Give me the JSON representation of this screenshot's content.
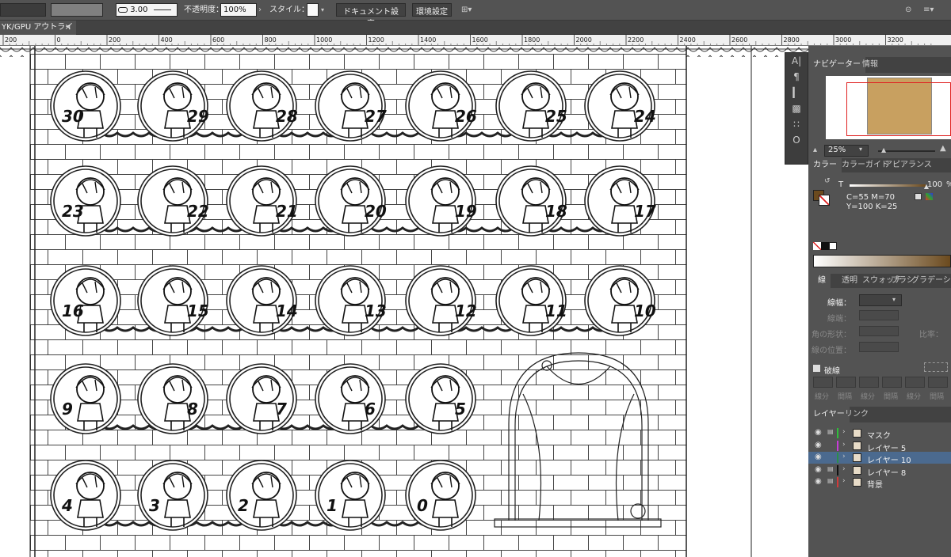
{
  "toolbar": {
    "stroke_weight": "3.00",
    "opacity_label": "不透明度：",
    "opacity_value": "100%",
    "style_label": "スタイル：",
    "doc_settings_button": "ドキュメント設定",
    "preferences_button": "環境設定"
  },
  "doc_tab": {
    "title": "YK/GPU アウトライン)",
    "close": "×"
  },
  "ruler": {
    "labels": [
      "200",
      "0",
      "200",
      "400",
      "600",
      "800",
      "1000",
      "1200",
      "1400",
      "1600",
      "1800",
      "2000",
      "2200",
      "2400",
      "2600",
      "2800",
      "3000",
      "3200"
    ]
  },
  "artwork": {
    "medallion_numbers": [
      "30",
      "29",
      "28",
      "27",
      "26",
      "25",
      "24",
      "23",
      "22",
      "21",
      "20",
      "19",
      "18",
      "17",
      "16",
      "15",
      "14",
      "13",
      "12",
      "11",
      "10",
      "9",
      "8",
      "7",
      "6",
      "5",
      "4",
      "3",
      "2",
      "1",
      "0"
    ]
  },
  "navigator": {
    "tab_navigator": "ナビゲーター",
    "tab_info": "情報",
    "zoom": "25%"
  },
  "color_panel": {
    "tab_color": "カラー",
    "tab_color_guide": "カラーガイド",
    "tab_appearance": "アピアランス",
    "tint_label": "T",
    "tint_value": "100",
    "tint_unit": "%",
    "cmyk_line1": "C=55 M=70",
    "cmyk_line2": "Y=100 K=25",
    "swatch_color": "#6b4a1e"
  },
  "stroke_panel": {
    "tab_stroke": "線",
    "tab_transparency": "透明",
    "tab_swatches": "スウォッチ",
    "tab_brush": "ブラシ",
    "tab_gradient": "グラデーション",
    "weight_label": "線幅：",
    "cap_label": "線端：",
    "corner_label": "角の形状：",
    "ratio_label": "比率：",
    "align_label": "線の位置："
  },
  "pathfinder": {
    "title": "破線",
    "labels": [
      "線分",
      "間隔",
      "線分",
      "間隔",
      "線分",
      "間隔"
    ]
  },
  "layers_panel": {
    "tab_layers": "レイヤー",
    "tab_links": "リンク",
    "layers": [
      {
        "name": "マスク",
        "color": "#2fbf3a",
        "locked": true,
        "selected": false
      },
      {
        "name": "レイヤー 5",
        "color": "#c83bd8",
        "locked": false,
        "selected": false
      },
      {
        "name": "レイヤー 10",
        "color": "#2b8f4a",
        "locked": false,
        "selected": true
      },
      {
        "name": "レイヤー 8",
        "color": "#111111",
        "locked": true,
        "selected": false
      },
      {
        "name": "背景",
        "color": "#d23a3a",
        "locked": true,
        "selected": false
      }
    ]
  }
}
